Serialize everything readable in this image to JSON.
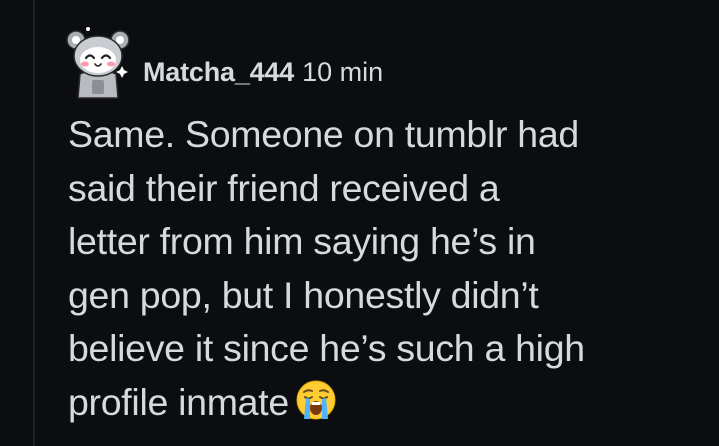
{
  "comment": {
    "author": "Matcha_444",
    "timestamp": "10 min",
    "body": "Same. Someone on tumblr had\nsaid their friend received a\nletter from him saying he’s in\ngen pop, but I honestly didn’t\nbelieve it since he’s such a high\nprofile inmate",
    "avatar_icon": "snoo-avatar-icon",
    "emoji_icon": "loudly-crying-face-icon"
  },
  "colors": {
    "background": "#0b0d10",
    "text": "#d7dadc",
    "thread_line": "#1c1f24"
  }
}
